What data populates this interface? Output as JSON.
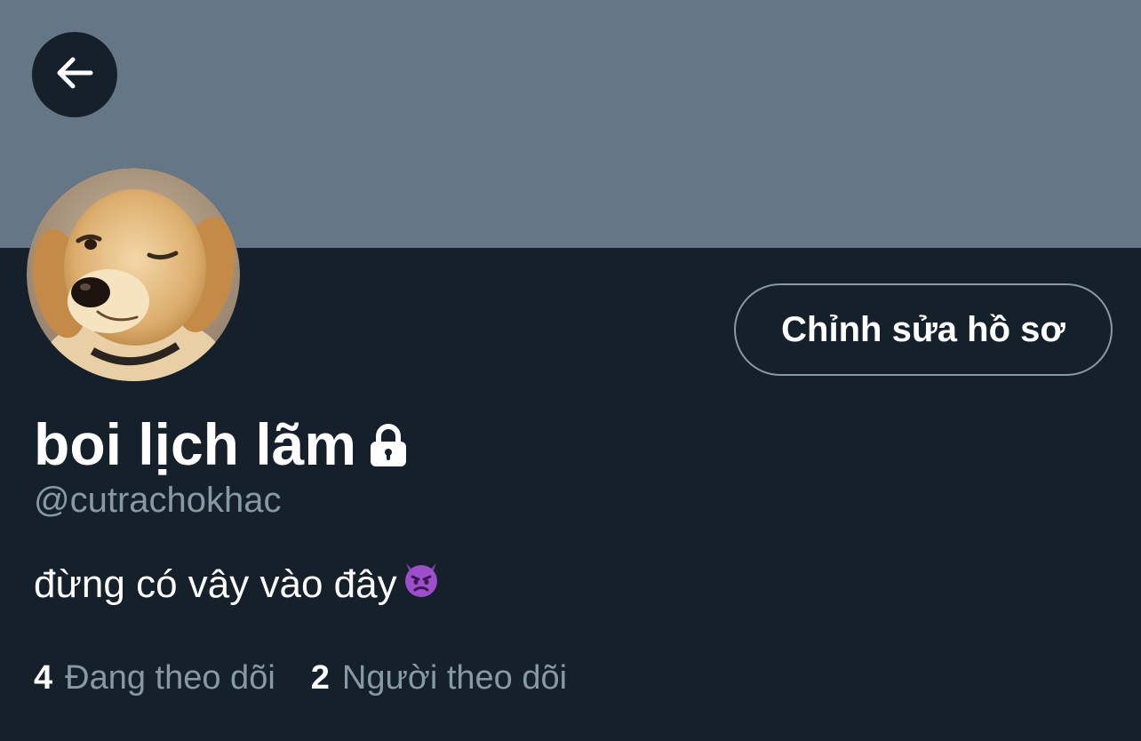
{
  "profile": {
    "display_name": "boi lịch lãm",
    "handle": "@cutrachokhac",
    "bio": "đừng có vây vào đây",
    "bio_emoji": "smiling-imp-emoji",
    "avatar": "golden-retriever-puppy-winking",
    "protected_icon": "lock-icon"
  },
  "actions": {
    "back_icon": "arrow-left-icon",
    "edit_profile_label": "Chỉnh sửa hồ sơ"
  },
  "stats": {
    "following_count": "4",
    "following_label": "Đang theo dõi",
    "followers_count": "2",
    "followers_label": "Người theo dõi"
  },
  "colors": {
    "background": "#15202b",
    "banner": "#657786",
    "secondary_text": "#8899a6",
    "primary_text": "#ffffff"
  }
}
